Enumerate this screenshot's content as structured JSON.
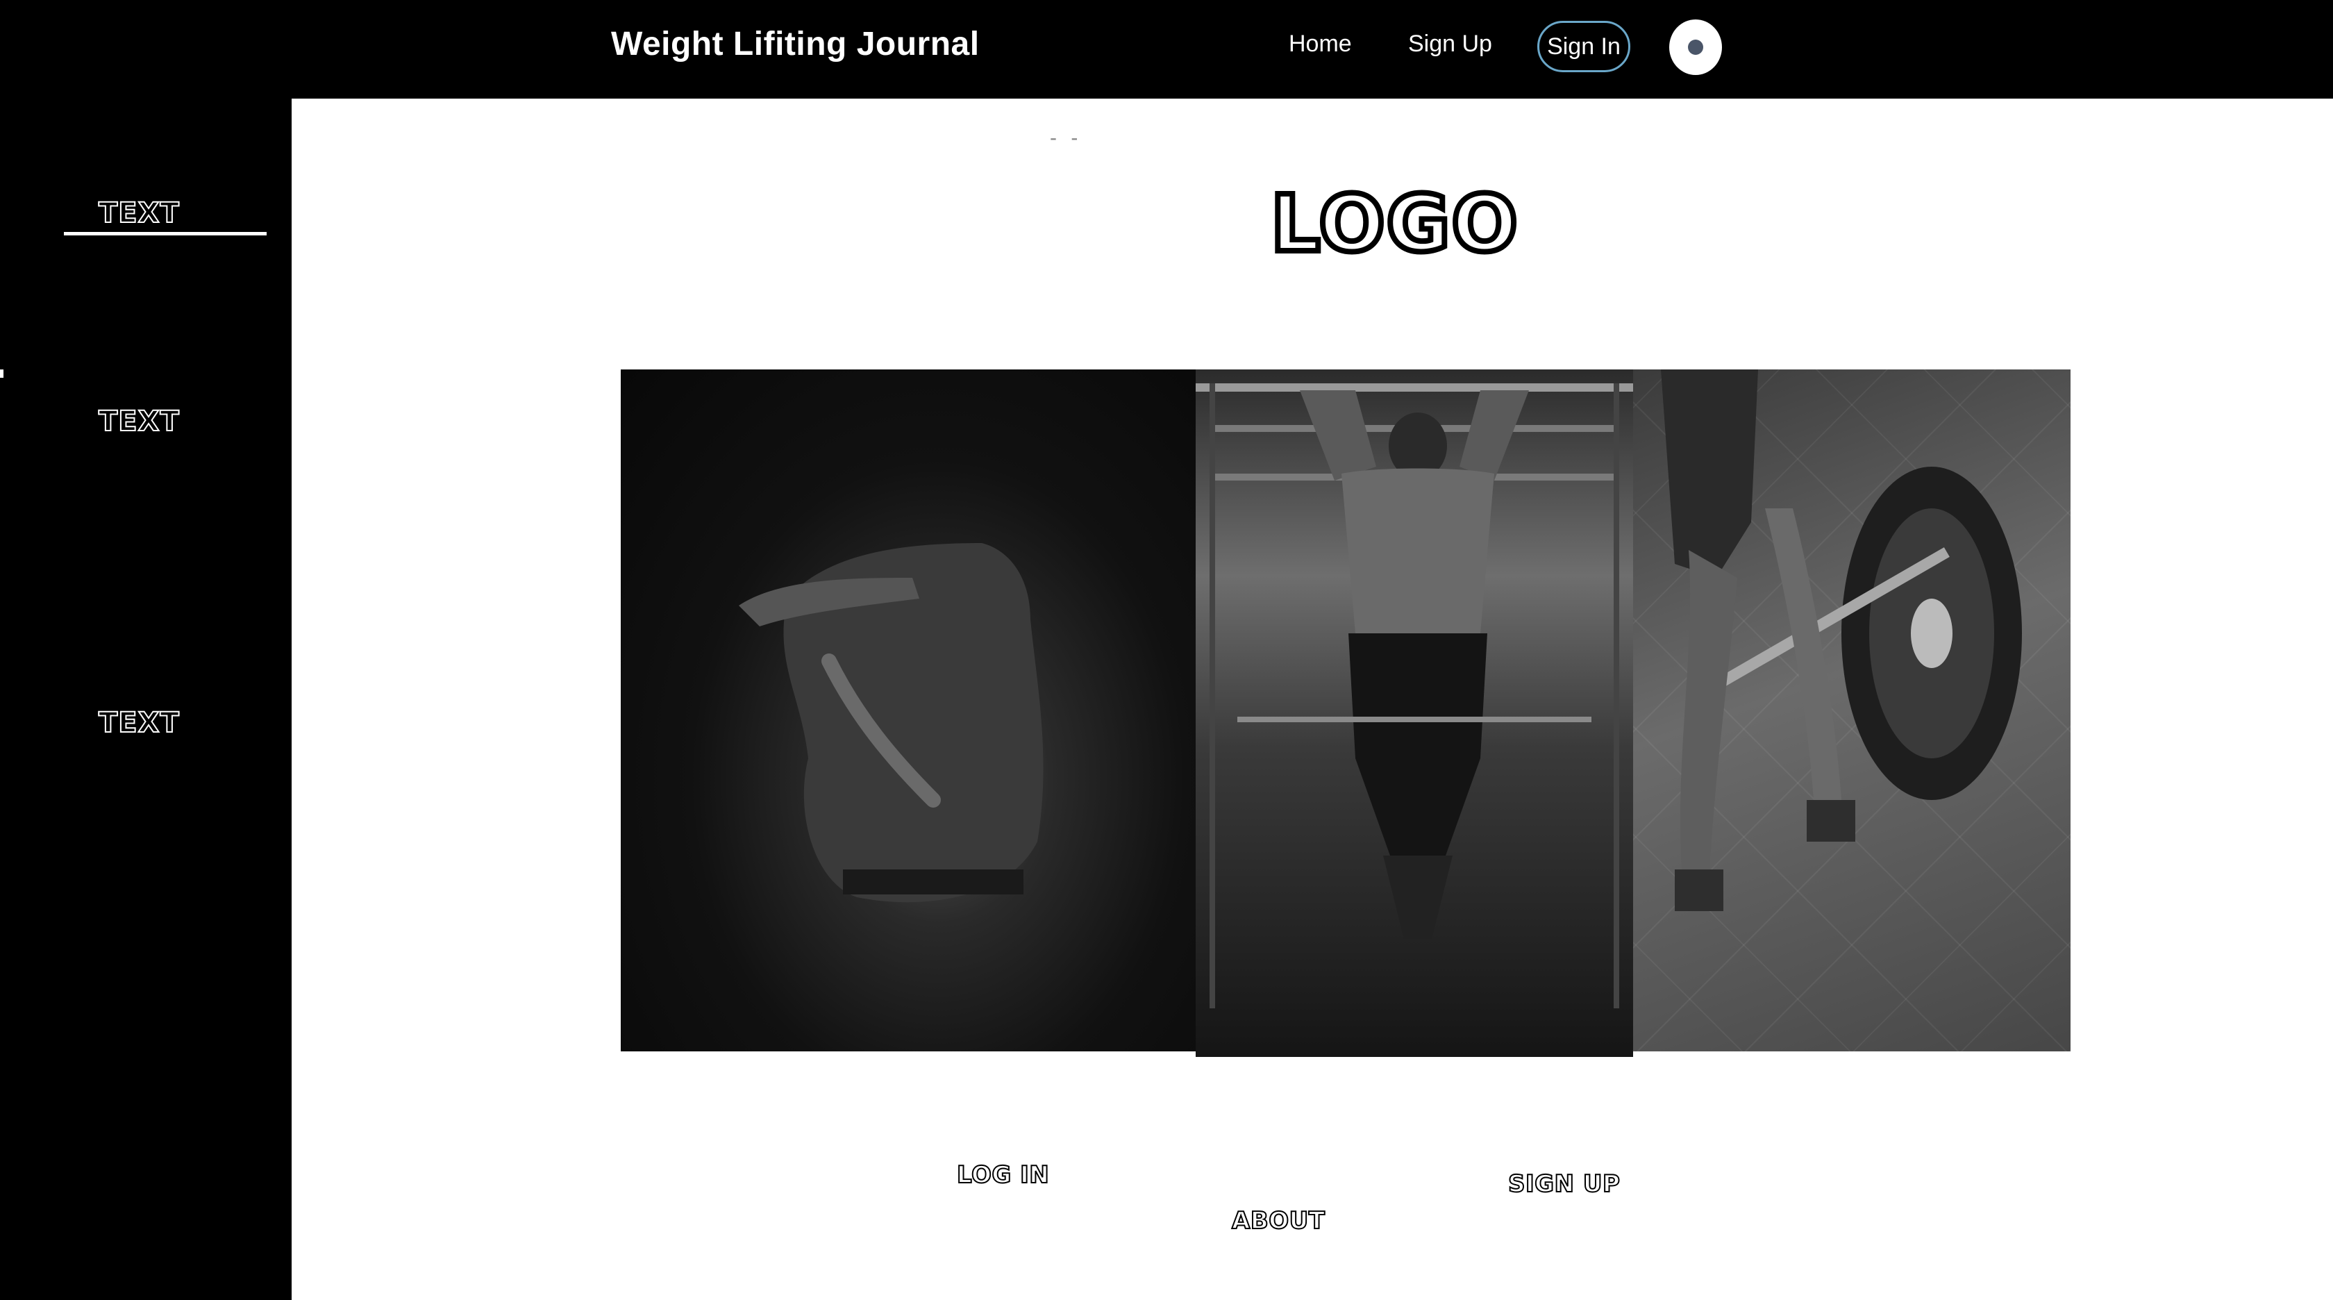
{
  "header": {
    "brand": "Weight Lifiting Journal",
    "nav": [
      {
        "label": "Home"
      },
      {
        "label": "Sign Up"
      }
    ],
    "signin_label": "Sign In",
    "theme_toggle_icon": "theme-toggle-icon"
  },
  "sidebar": {
    "items": [
      {
        "label": "TEXT"
      },
      {
        "label": "TEXT"
      },
      {
        "label": "TEXT"
      }
    ]
  },
  "main": {
    "dashes": "- -",
    "logo": "LOGO",
    "images": [
      {
        "alt": "woman stretching arm behind back"
      },
      {
        "alt": "man doing pull-ups"
      },
      {
        "alt": "person lifting barbell"
      }
    ],
    "links": {
      "login": "LOG IN",
      "about": "ABOUT",
      "signup": "SIGN UP"
    }
  },
  "colors": {
    "bar": "#000000",
    "background": "#ffffff",
    "signin_border": "#6aa7c9"
  }
}
